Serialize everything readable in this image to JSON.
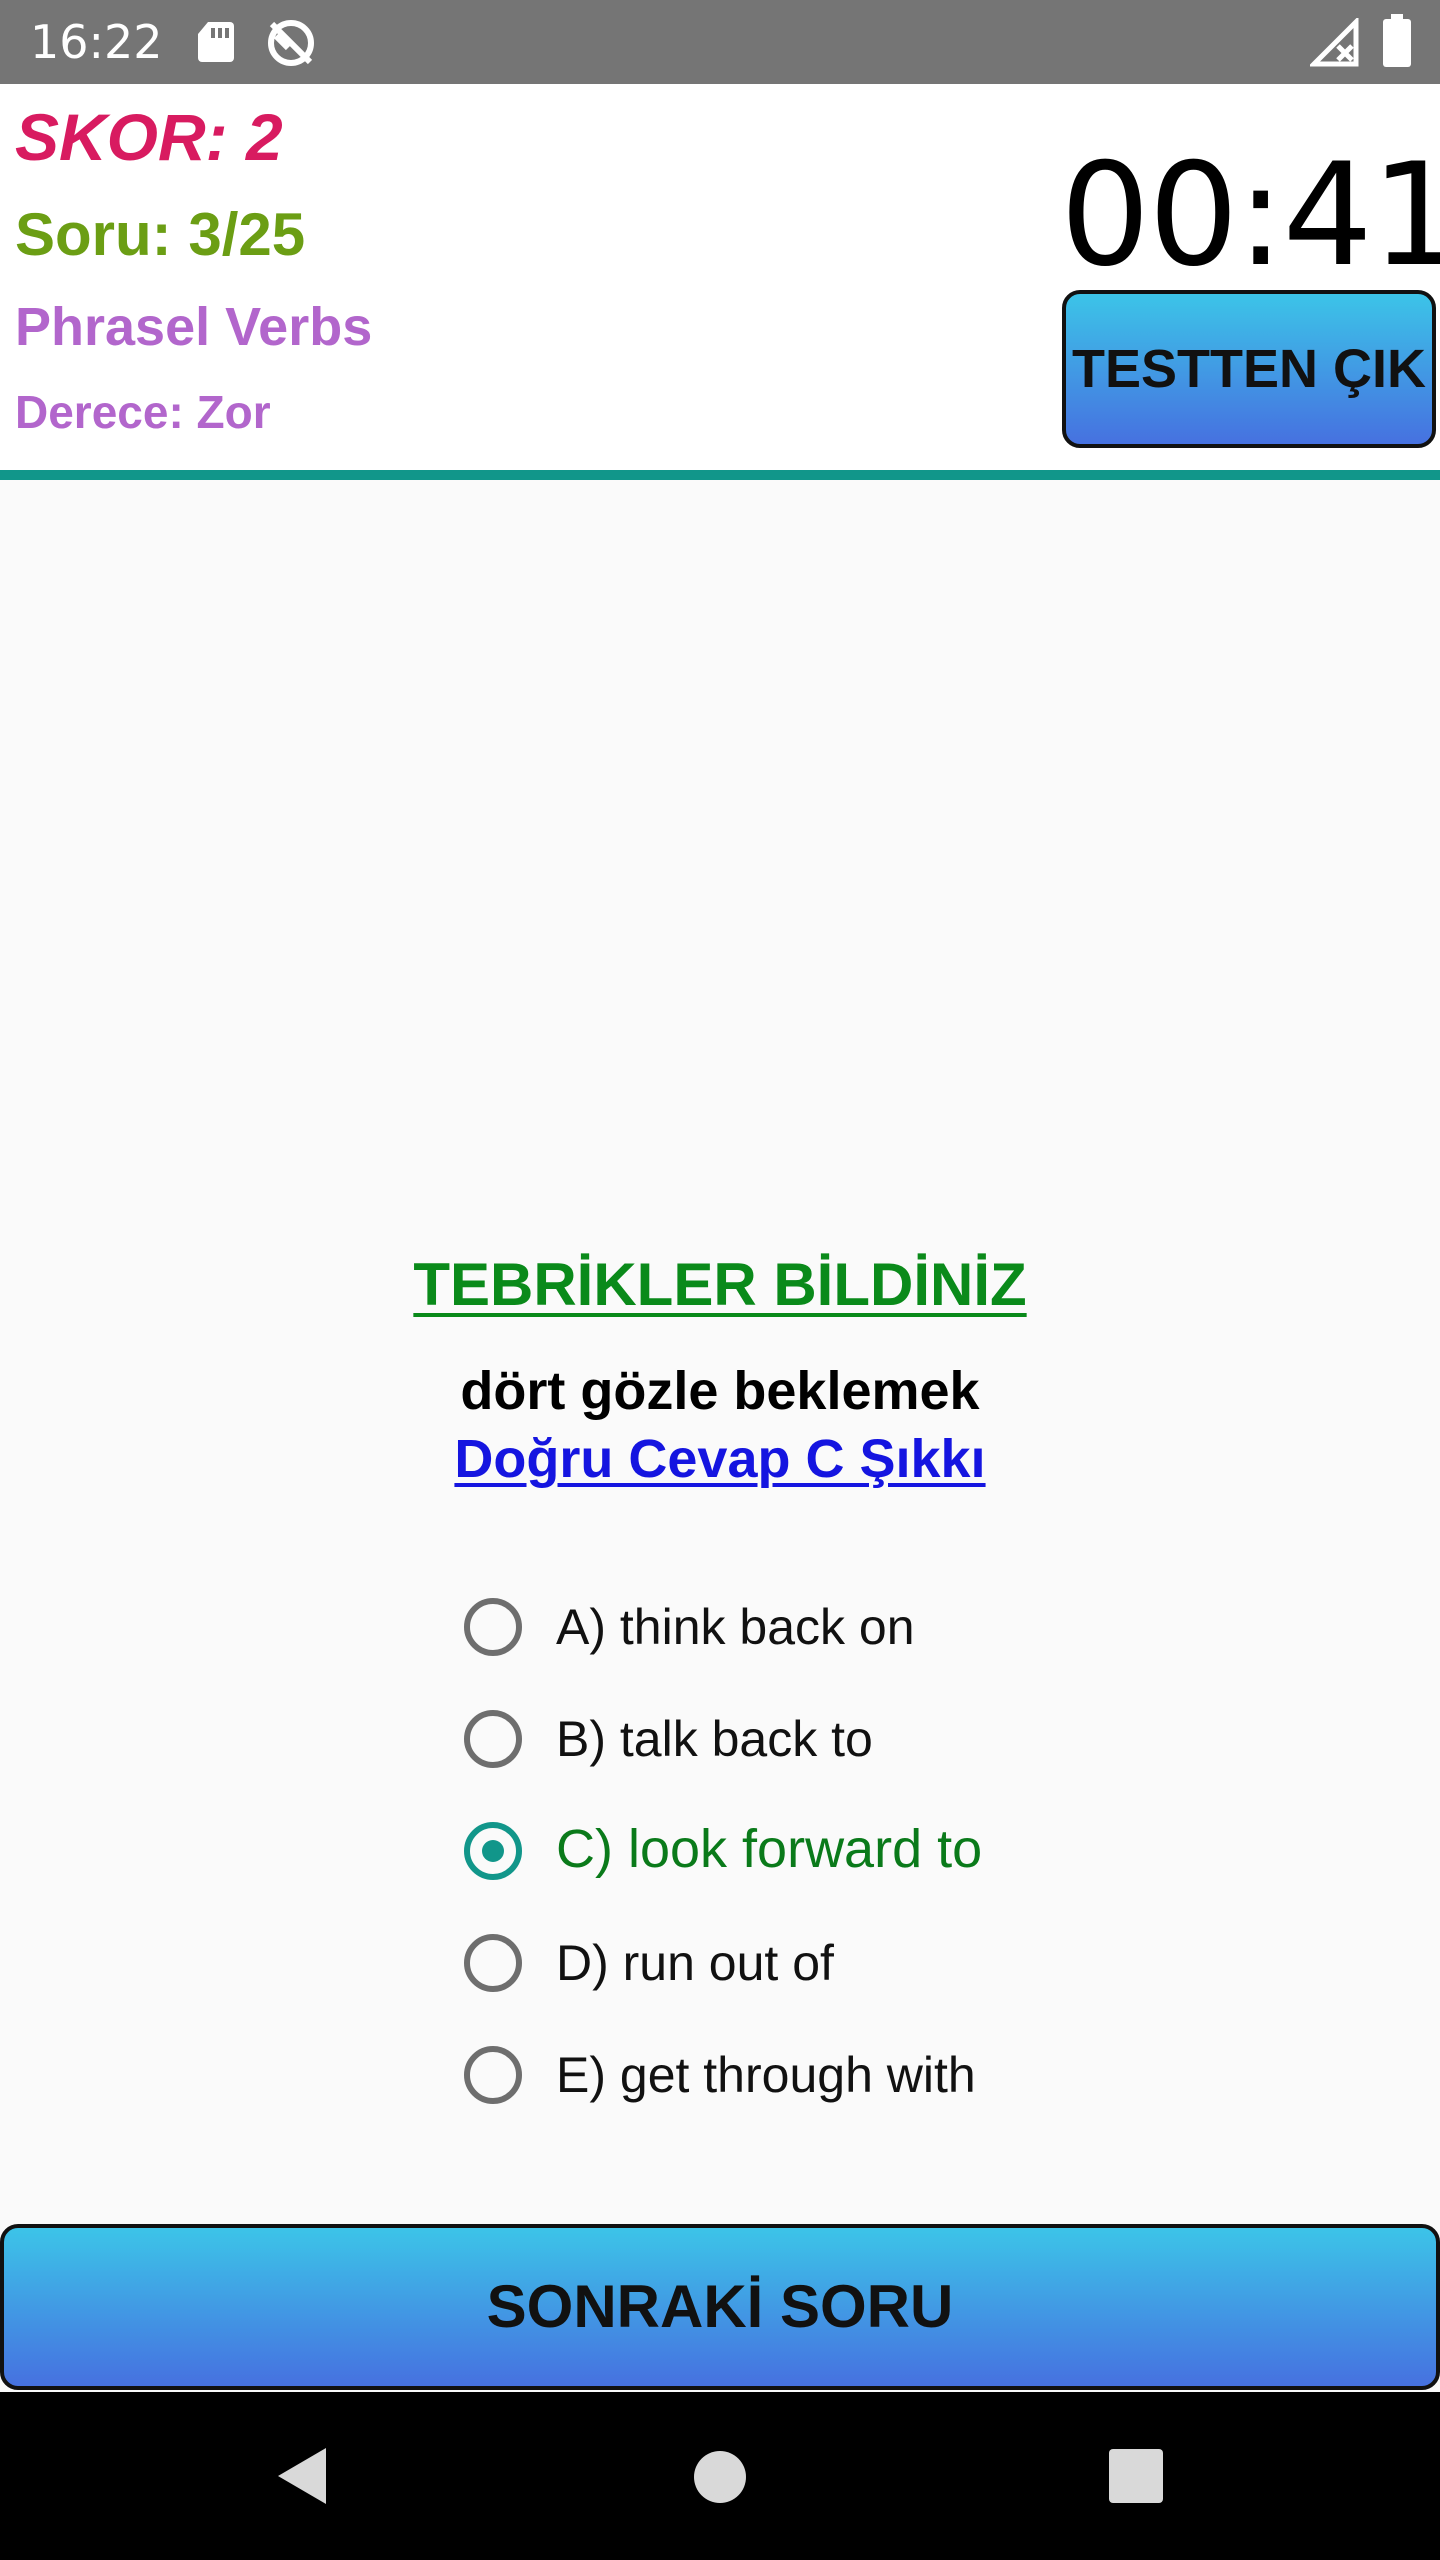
{
  "status_bar": {
    "time": "16:22",
    "icons": [
      "sd-card-icon",
      "sync-off-icon",
      "signal-no-service-icon",
      "battery-icon"
    ]
  },
  "header": {
    "score": "SKOR: 2",
    "question_no": "Soru: 3/25",
    "category": "Phrasel Verbs",
    "difficulty": "Derece: Zor",
    "timer": "00:41",
    "exit_label": "TESTTEN ÇIK"
  },
  "result": {
    "title": "TEBRİKLER BİLDİNİZ",
    "meaning": "dört gözle beklemek",
    "correct_answer": "Doğru Cevap C Şıkkı"
  },
  "options": [
    {
      "label": "A) think back on",
      "selected": false
    },
    {
      "label": "B) talk back to",
      "selected": false
    },
    {
      "label": "C) look forward to",
      "selected": true
    },
    {
      "label": "D) run out of",
      "selected": false
    },
    {
      "label": "E) get through with",
      "selected": false
    }
  ],
  "next_button": "SONRAKİ SORU",
  "nav_bar": {
    "icons": [
      "back-icon",
      "home-icon",
      "recents-icon"
    ]
  },
  "colors": {
    "score": "#d81b60",
    "question_no": "#6b9e14",
    "category": "#b266cc",
    "accent": "#11968a",
    "correct": "#0a8a1a",
    "link": "#1515e0"
  }
}
